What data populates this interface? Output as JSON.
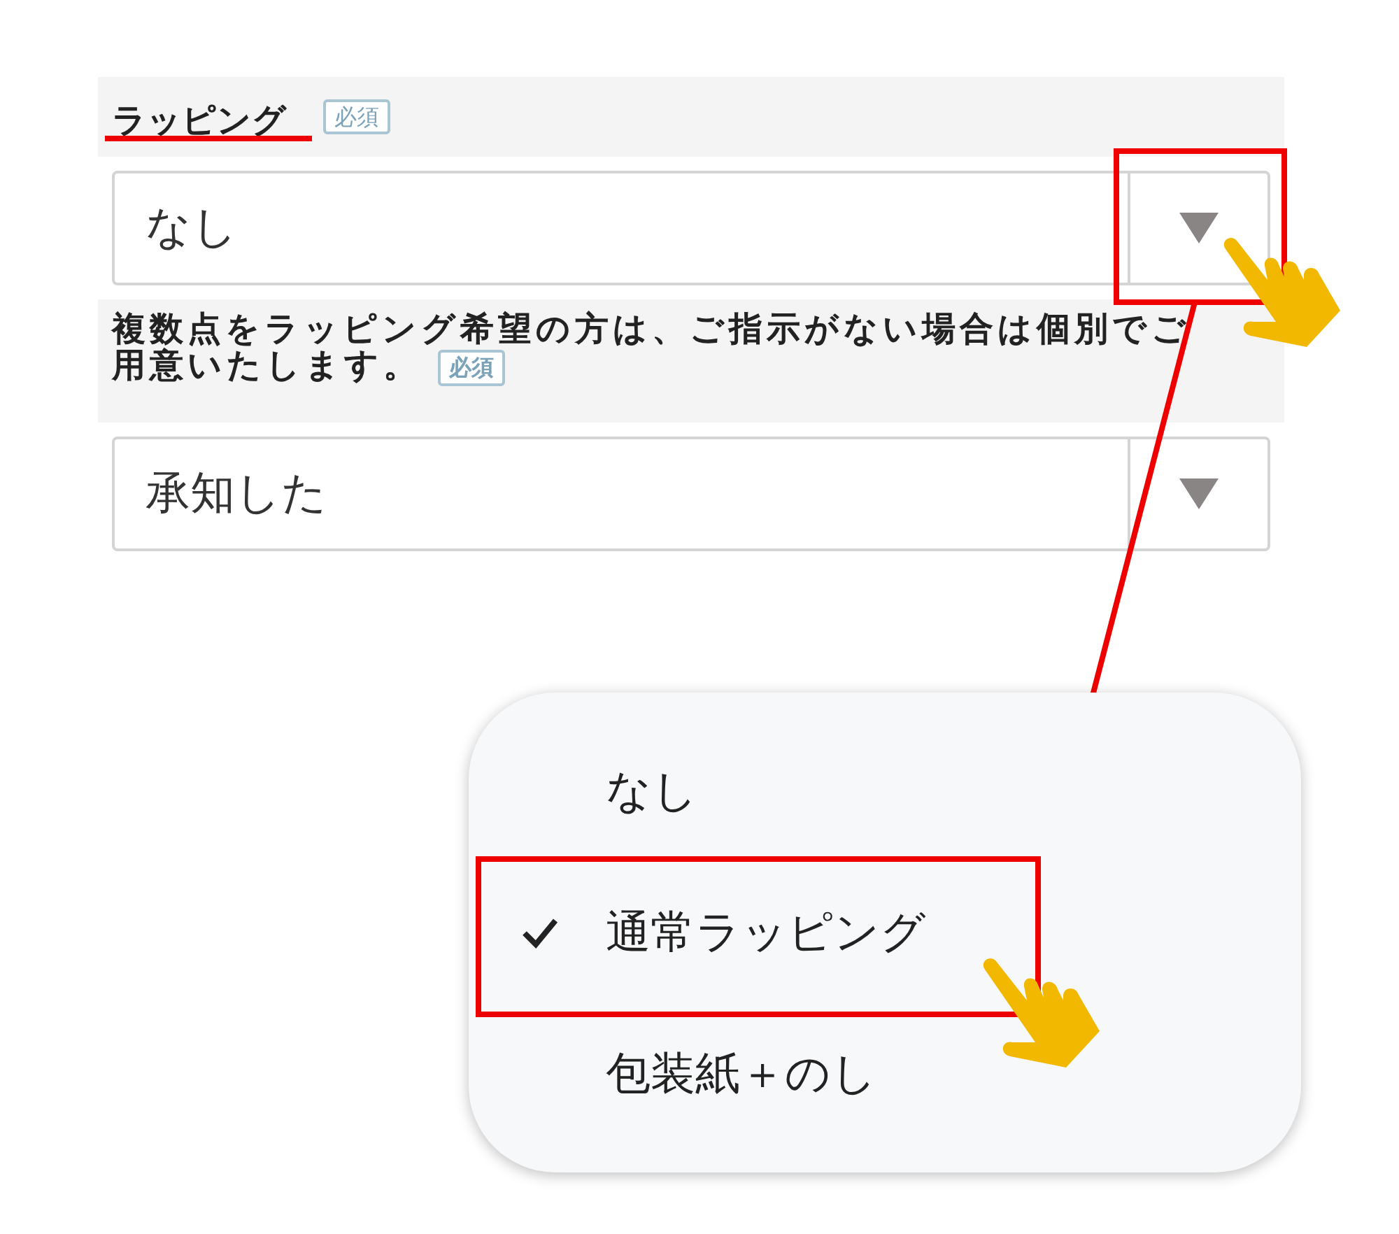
{
  "wrapping_field": {
    "label": "ラッピング",
    "required_badge": "必須",
    "value": "なし"
  },
  "notice_field": {
    "text": "複数点をラッピング希望の方は、ご指示がない場合は個別でご用意いたします。",
    "required_badge": "必須",
    "value": "承知した"
  },
  "dropdown": {
    "options": [
      {
        "label": "なし",
        "selected": false
      },
      {
        "label": "通常ラッピング",
        "selected": true
      },
      {
        "label": "包装紙＋のし",
        "selected": false
      }
    ]
  }
}
